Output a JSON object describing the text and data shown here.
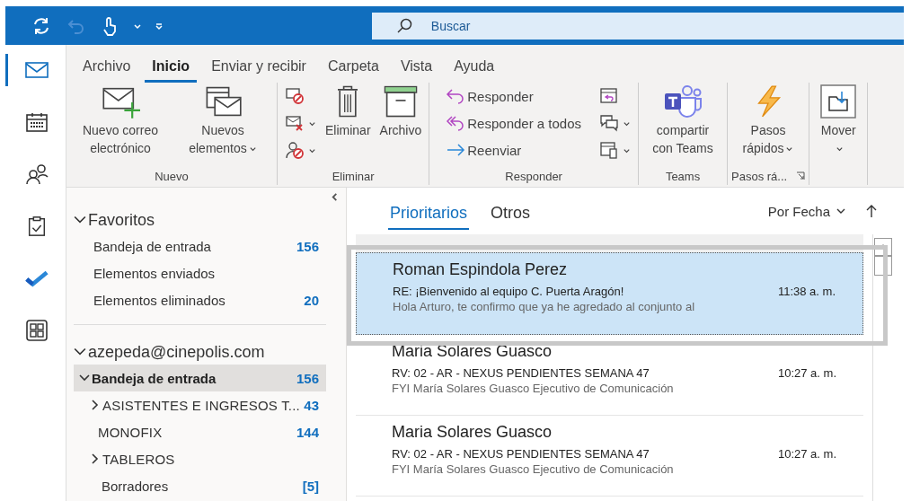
{
  "title_bar": {
    "search": {
      "placeholder": "Buscar"
    }
  },
  "nav_rail": [
    {
      "kind": "mail",
      "selected": true
    },
    {
      "kind": "calendar",
      "selected": false
    },
    {
      "kind": "people",
      "selected": false
    },
    {
      "kind": "tasks",
      "selected": false
    },
    {
      "kind": "todo",
      "selected": false
    },
    {
      "kind": "apps",
      "selected": false
    }
  ],
  "menu_tabs": [
    {
      "label": "Archivo",
      "selected": false
    },
    {
      "label": "Inicio",
      "selected": true
    },
    {
      "label": "Enviar y recibir",
      "selected": false
    },
    {
      "label": "Carpeta",
      "selected": false
    },
    {
      "label": "Vista",
      "selected": false
    },
    {
      "label": "Ayuda",
      "selected": false
    }
  ],
  "ribbon_groups": [
    {
      "label": "Nuevo",
      "buttons": [
        {
          "kind": "new-mail",
          "label": "Nuevo correo electrónico",
          "dropdown": false
        },
        {
          "kind": "new-items",
          "label": "Nuevos elementos",
          "dropdown": true
        }
      ]
    },
    {
      "label": "Eliminar",
      "buttons": [
        {
          "kind": "small-stack"
        },
        {
          "kind": "delete",
          "label": "Eliminar",
          "dropdown": false
        },
        {
          "kind": "archive",
          "label": "Archivo",
          "dropdown": false
        }
      ]
    },
    {
      "label": "Responder",
      "buttons": [
        {
          "kind": "reply-stack",
          "items": [
            {
              "kind": "reply",
              "label": "Responder"
            },
            {
              "kind": "reply-all",
              "label": "Responder a todos"
            },
            {
              "kind": "forward",
              "label": "Reenviar"
            }
          ]
        },
        {
          "kind": "small-stack-2"
        }
      ]
    },
    {
      "label": "Teams",
      "buttons": [
        {
          "kind": "teams",
          "label": "compartir con Teams",
          "dropdown": false
        }
      ]
    },
    {
      "label": "Pasos rá...",
      "launcher": true,
      "buttons": [
        {
          "kind": "quick-steps",
          "label": "Pasos rápidos",
          "dropdown": true
        }
      ]
    },
    {
      "buttons": [
        {
          "kind": "move",
          "label": "Mover",
          "dropdown": true
        }
      ]
    }
  ],
  "folder_pane": {
    "favorites": {
      "label": "Favoritos",
      "expanded": true,
      "items": [
        {
          "label": "Bandeja de entrada",
          "count": "156",
          "selected": false
        },
        {
          "label": "Elementos enviados",
          "selected": false
        },
        {
          "label": "Elementos eliminados",
          "count": "20",
          "selected": false
        }
      ]
    },
    "account": {
      "label": "azepeda@cinepolis.com",
      "expanded": true,
      "folders": [
        {
          "label": "Bandeja de entrada",
          "count": "156",
          "expanded": true,
          "selected": true,
          "children": [
            {
              "label": "ASISTENTES E INGRESOS T...",
              "count": "43",
              "expanded": false,
              "selected": false
            },
            {
              "label": "MONOFIX",
              "count": "144",
              "selected": false
            },
            {
              "label": "TABLEROS",
              "expanded": false,
              "selected": false
            }
          ]
        },
        {
          "label": "Borradores",
          "count": "[5]",
          "selected": false
        }
      ]
    }
  },
  "message_list": {
    "tabs": [
      {
        "label": "Prioritarios",
        "selected": true
      },
      {
        "label": "Otros",
        "selected": false
      }
    ],
    "sort": "Por Fecha",
    "messages": [
      {
        "sender": "Roman Espindola Perez",
        "subject": "RE: ¡Bienvenido al equipo C. Puerta Aragón!",
        "preview": "Hola Arturo, te confirmo que ya he agredado al conjunto al",
        "time": "11:38 a. m.",
        "selected": true
      },
      {
        "sender": "Maria Solares Guasco",
        "subject": "RV: 02 - AR - NEXUS PENDIENTES SEMANA 47",
        "preview": "FYI  María Solares Guasco  Ejecutivo de Comunicación",
        "time": "10:27 a. m.",
        "selected": false
      },
      {
        "sender": "Maria Solares Guasco",
        "subject": "RV: 02 - AR - NEXUS PENDIENTES SEMANA 47",
        "preview": "FYI  María Solares Guasco  Ejecutivo de Comunicación",
        "time": "10:27 a. m.",
        "selected": false
      }
    ]
  }
}
